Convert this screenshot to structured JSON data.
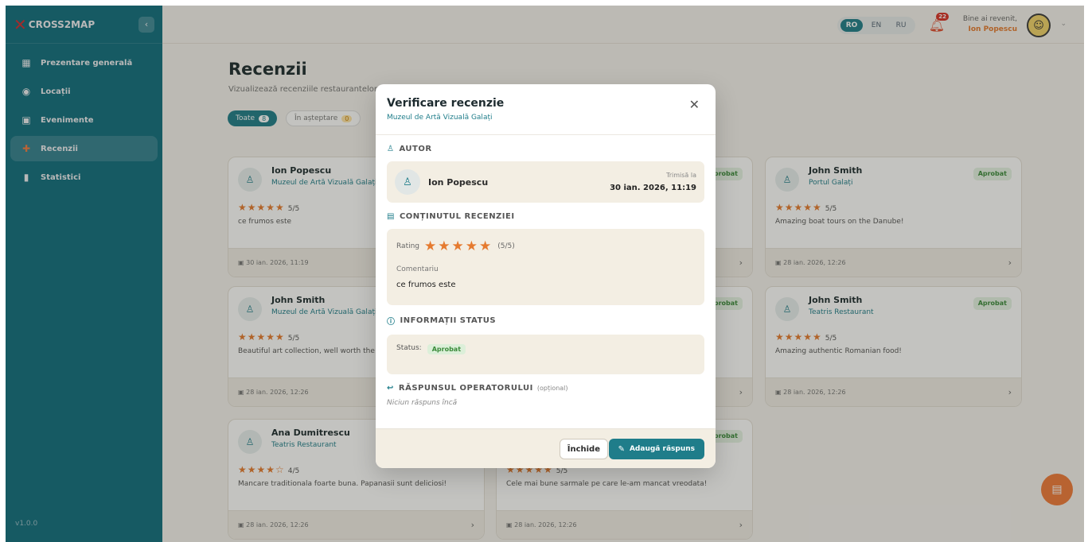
{
  "sidebar": {
    "logo": "CROSS2MAP",
    "items": [
      {
        "label": "Prezentare generală",
        "icon": "grid-icon"
      },
      {
        "label": "Locații",
        "icon": "location-icon"
      },
      {
        "label": "Evenimente",
        "icon": "calendar-icon"
      },
      {
        "label": "Recenzii",
        "icon": "review-icon"
      },
      {
        "label": "Statistici",
        "icon": "chart-icon"
      }
    ],
    "version": "v1.0.0"
  },
  "topbar": {
    "languages": [
      "RO",
      "EN",
      "RU"
    ],
    "active_language": "RO",
    "notifications": "22",
    "greeting": "Bine ai revenit,",
    "user_name": "Ion Popescu"
  },
  "page": {
    "title": "Recenzii",
    "subtitle": "Vizualizează recenziile restaurantelor",
    "filters": [
      {
        "label": "Toate",
        "count": "8"
      },
      {
        "label": "În așteptare",
        "count": "0"
      }
    ]
  },
  "cards": [
    {
      "name": "Ion Popescu",
      "location": "Muzeul de Artă Vizuală Galați",
      "badge": "",
      "stars": "★★★★★",
      "score": "5/5",
      "text": "ce frumos este",
      "date": "30 ian. 2026, 11:19"
    },
    {
      "name": "John Smith",
      "location": "Portul Galați",
      "badge": "Aprobat",
      "stars": "★★★★★",
      "score": "5/5",
      "text": "Amazing boat tours on the Danube!",
      "date": "28 ian. 2026, 12:26"
    },
    {
      "name": "John Smith",
      "location": "Muzeul de Artă Vizuală Galați",
      "badge": "",
      "stars": "★★★★★",
      "score": "5/5",
      "text": "Beautiful art collection, well worth the v",
      "date": "28 ian. 2026, 12:26"
    },
    {
      "name": "John Smith",
      "location": "Teatris Restaurant",
      "badge": "Aprobat",
      "stars": "★★★★★",
      "score": "5/5",
      "text": "Amazing authentic Romanian food!",
      "date": "28 ian. 2026, 12:26"
    },
    {
      "name": "Ana Dumitrescu",
      "location": "Teatris Restaurant",
      "badge": "",
      "stars": "★★★★☆",
      "score": "4/5",
      "text": "Mancare traditionala foarte buna. Papanasii sunt deliciosi!",
      "date": "28 ian. 2026, 12:26"
    },
    {
      "name": "",
      "location": "",
      "badge": "Aprobat",
      "stars": "★★★★★",
      "score": "5/5",
      "text": "Cele mai bune sarmale pe care le-am mancat vreodata!",
      "date": "28 ian. 2026, 12:26"
    }
  ],
  "middle_badges": [
    "Aprobat",
    "Aprobat",
    "Aprobat"
  ],
  "modal": {
    "title": "Verificare recenzie",
    "subtitle": "Muzeul de Artă Vizuală Galați",
    "author_section": "AUTOR",
    "author_name": "Ion Popescu",
    "sent_label": "Trimisă la",
    "sent_date": "30 ian. 2026, 11:19",
    "content_section": "CONȚINUTUL RECENZIEI",
    "rating_label": "Rating",
    "rating_stars": "★★★★★",
    "rating_value": "(5/5)",
    "comment_label": "Comentariu",
    "comment_text": "ce frumos este",
    "status_section": "INFORMAȚII STATUS",
    "status_label": "Status:",
    "status_value": "Aprobat",
    "reply_section": "RĂSPUNSUL OPERATORULUI",
    "reply_optional": "(opțional)",
    "reply_empty": "Niciun răspuns încă",
    "close_label": "Închide",
    "add_reply_label": "Adaugă răspuns"
  },
  "colors": {
    "primary": "#1f7d8a",
    "accent": "#e57a2f",
    "approved": "#3a8a3a"
  }
}
